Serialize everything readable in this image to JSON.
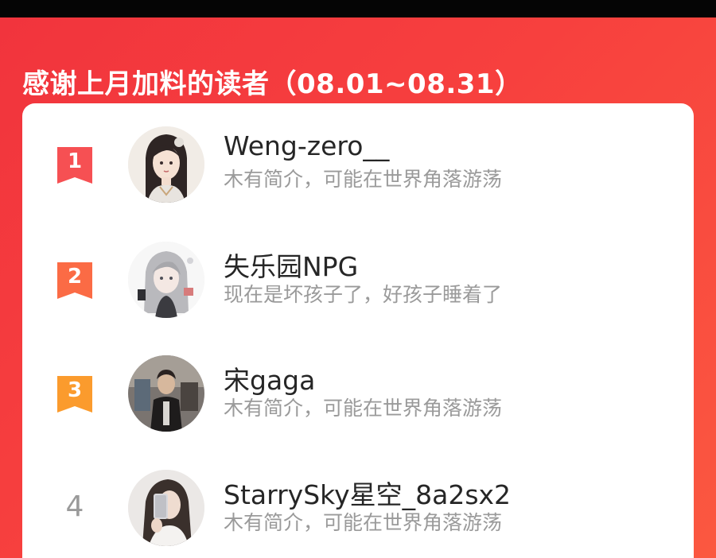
{
  "header": {
    "title": "感谢上月加料的读者（08.01~08.31）"
  },
  "colors": {
    "banner_red": "#f4383d",
    "rank1": "#f65053",
    "rank2": "#fb6b45",
    "rank3": "#fb9b2d",
    "name_text": "#262626",
    "bio_text": "#9a9a9a"
  },
  "readers": [
    {
      "rank": "1",
      "name": "Weng-zero__",
      "bio": "木有简介，可能在世界角落游荡",
      "avatar_icon": "anime-girl-avatar"
    },
    {
      "rank": "2",
      "name": "失乐园NPG",
      "bio": "现在是坏孩子了，好孩子睡着了",
      "avatar_icon": "anime-gray-hair-avatar"
    },
    {
      "rank": "3",
      "name": "宋gaga",
      "bio": "木有简介，可能在世界角落游荡",
      "avatar_icon": "photo-person-avatar"
    },
    {
      "rank": "4",
      "name": "StarrySky星空_8a2sx2",
      "bio": "木有简介，可能在世界角落游荡",
      "avatar_icon": "selfie-avatar"
    }
  ]
}
